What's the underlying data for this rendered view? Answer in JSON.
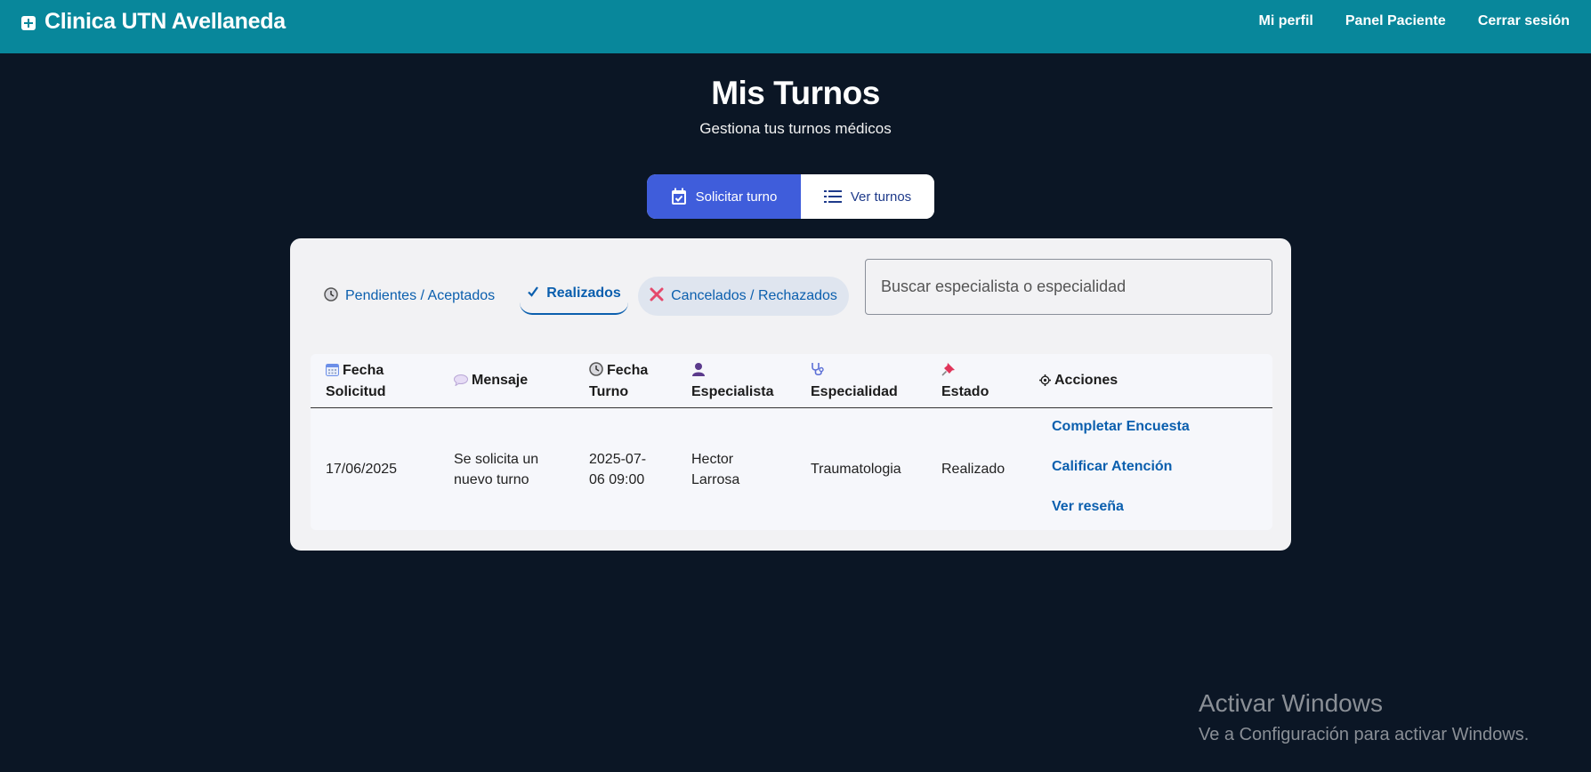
{
  "navbar": {
    "brand": "Clinica UTN Avellaneda",
    "links": [
      "Mi perfil",
      "Panel Paciente",
      "Cerrar sesión"
    ]
  },
  "header": {
    "title": "Mis Turnos",
    "subtitle": "Gestiona tus turnos médicos"
  },
  "toggle": {
    "solicitar": "Solicitar turno",
    "ver": "Ver turnos"
  },
  "filters": {
    "pendientes": "Pendientes / Aceptados",
    "realizados": "Realizados",
    "cancelados": "Cancelados / Rechazados",
    "search_placeholder": "Buscar especialista o especialidad"
  },
  "table": {
    "headers": {
      "fecha_solicitud": [
        "Fecha",
        "Solicitud"
      ],
      "mensaje": "Mensaje",
      "fecha_turno": [
        "Fecha",
        "Turno"
      ],
      "especialista": "Especialista",
      "especialidad": "Especialidad",
      "estado": "Estado",
      "acciones": "Acciones"
    },
    "rows": [
      {
        "fecha_solicitud": "17/06/2025",
        "mensaje": [
          "Se solicita un",
          "nuevo turno"
        ],
        "fecha_turno": [
          "2025-07-",
          "06 09:00"
        ],
        "especialista": [
          "Hector",
          "Larrosa"
        ],
        "especialidad": "Traumatologia",
        "estado": "Realizado",
        "acciones": [
          "Completar Encuesta",
          "Calificar Atención",
          "Ver reseña"
        ]
      }
    ]
  },
  "watermark": {
    "title": "Activar Windows",
    "subtitle": "Ve a Configuración para activar Windows."
  },
  "colors": {
    "navbar": "#08879b",
    "background": "#0b1625",
    "accent": "#3f5ddb",
    "link": "#0b5fae"
  }
}
